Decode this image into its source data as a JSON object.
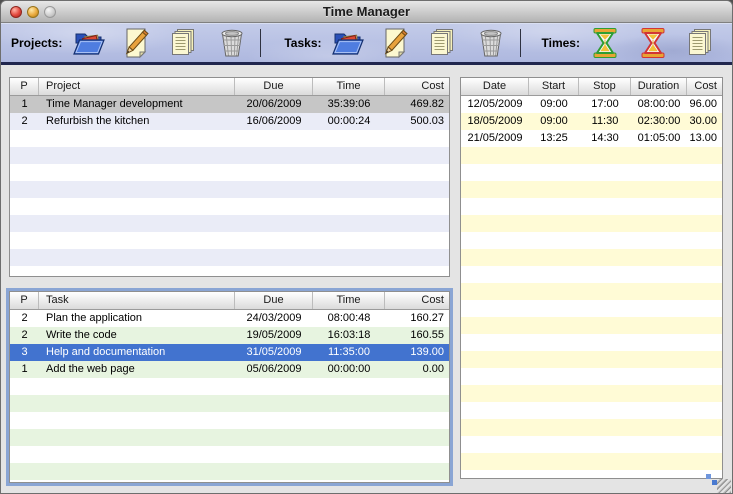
{
  "window": {
    "title": "Time Manager",
    "controls": [
      "close",
      "minimize",
      "zoom"
    ]
  },
  "colors": {
    "selection_active": "#4273cf",
    "selection_inactive": "#c6c6c6",
    "stripe_projects": "#eaecf7",
    "stripe_tasks": "#e7f4e0",
    "stripe_times": "#fffbd6",
    "focus_ring": "#8aa5d4",
    "toolbar_bg": "#b7c0e4"
  },
  "toolbar": {
    "groups": [
      {
        "id": "projects",
        "label": "Projects:",
        "buttons": [
          {
            "id": "open",
            "icon": "folder-open-icon"
          },
          {
            "id": "edit",
            "icon": "pencil-icon"
          },
          {
            "id": "copy",
            "icon": "pages-icon"
          },
          {
            "id": "delete",
            "icon": "trash-icon"
          }
        ]
      },
      {
        "id": "tasks",
        "label": "Tasks:",
        "buttons": [
          {
            "id": "open",
            "icon": "folder-open-icon"
          },
          {
            "id": "edit",
            "icon": "pencil-icon"
          },
          {
            "id": "copy",
            "icon": "pages-icon"
          },
          {
            "id": "delete",
            "icon": "trash-icon"
          }
        ]
      },
      {
        "id": "times",
        "label": "Times:",
        "buttons": [
          {
            "id": "start",
            "icon": "hourglass-start-icon"
          },
          {
            "id": "stop",
            "icon": "hourglass-stop-icon"
          },
          {
            "id": "copy",
            "icon": "pages-icon"
          },
          {
            "id": "calendar",
            "icon": "calendar-icon"
          },
          {
            "id": "delete",
            "icon": "trash-icon"
          }
        ]
      }
    ]
  },
  "projects_table": {
    "columns": [
      "P",
      "Project",
      "Due",
      "Time",
      "Cost"
    ],
    "rows": [
      [
        "1",
        "Time Manager development",
        "20/06/2009",
        "35:39:06",
        "469.82"
      ],
      [
        "2",
        "Refurbish the kitchen",
        "16/06/2009",
        "00:00:24",
        "500.03"
      ]
    ],
    "selected_index": 0,
    "focused": false
  },
  "tasks_table": {
    "columns": [
      "P",
      "Task",
      "Due",
      "Time",
      "Cost"
    ],
    "rows": [
      [
        "2",
        "Plan the application",
        "24/03/2009",
        "08:00:48",
        "160.27"
      ],
      [
        "2",
        "Write the code",
        "19/05/2009",
        "16:03:18",
        "160.55"
      ],
      [
        "3",
        "Help and documentation",
        "31/05/2009",
        "11:35:00",
        "139.00"
      ],
      [
        "1",
        "Add the web page",
        "05/06/2009",
        "00:00:00",
        "0.00"
      ]
    ],
    "selected_index": 2,
    "focused": true
  },
  "times_table": {
    "columns": [
      "Date",
      "Start",
      "Stop",
      "Duration",
      "Cost"
    ],
    "rows": [
      [
        "12/05/2009",
        "09:00",
        "17:00",
        "08:00:00",
        "96.00"
      ],
      [
        "18/05/2009",
        "09:00",
        "11:30",
        "02:30:00",
        "30.00"
      ],
      [
        "21/05/2009",
        "13:25",
        "14:30",
        "01:05:00",
        "13.00"
      ]
    ],
    "selected_index": -1,
    "focused": false
  }
}
